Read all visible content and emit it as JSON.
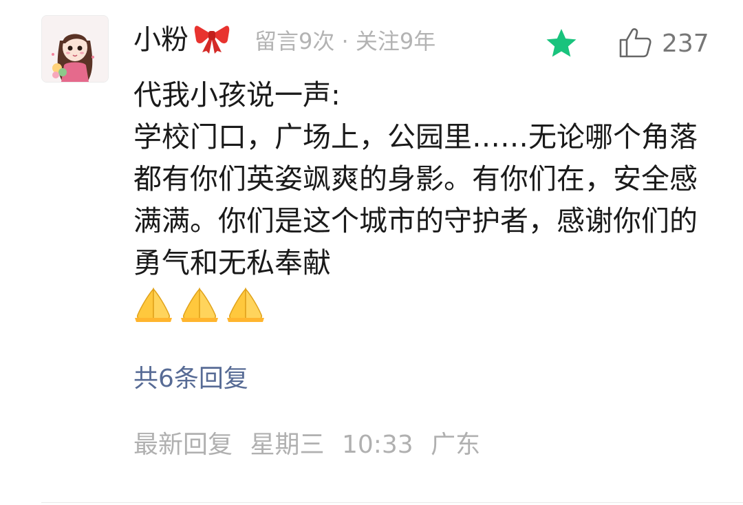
{
  "comment": {
    "username": "小粉",
    "meta": "留言9次 · 关注9年",
    "like_count": "237",
    "lines": [
      "代我小孩说一声:",
      "学校门口，广场上，公园里……无论哪个角落都有你们英姿飒爽的身影。有你们在，安全感满满。你们是这个城市的守护者，感谢你们的勇气和无私奉献"
    ],
    "emoji_name": "folded-hands-emoji",
    "emoji_count": 3,
    "replies_label": "共6条回复",
    "footer": {
      "label": "最新回复",
      "day": "星期三",
      "time": "10:33",
      "location": "广东"
    }
  },
  "colors": {
    "accent_star": "#19c37d",
    "link": "#576b95",
    "meta_text": "#b3b3b3",
    "body_text": "#1a1a1a"
  },
  "icons": {
    "featured": "star-icon",
    "like": "thumbs-up-icon",
    "decoration": "ribbon-bow-icon"
  }
}
